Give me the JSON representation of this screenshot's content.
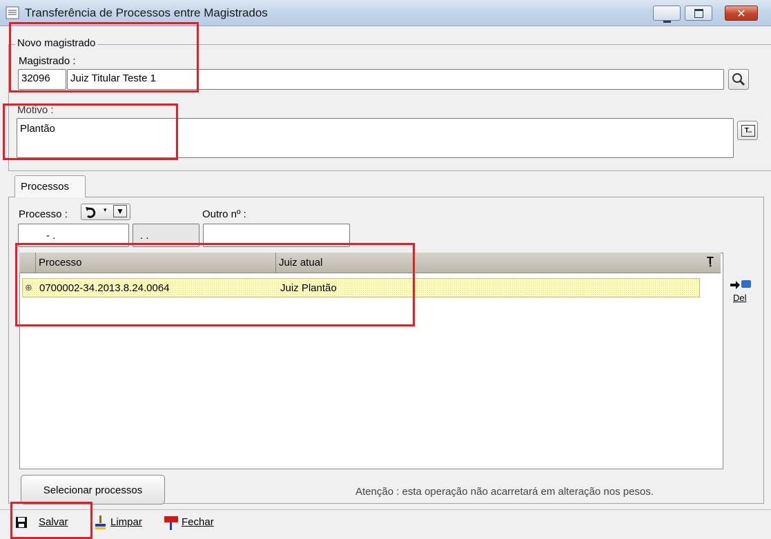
{
  "window": {
    "title": "Transferência de Processos entre Magistrados"
  },
  "novo_magistrado": {
    "legend": "Novo magistrado",
    "magistrado_label": "Magistrado :",
    "code": "32096",
    "name": "Juiz Titular Teste 1"
  },
  "motivo": {
    "label": "Motivo :",
    "value": "Plantão"
  },
  "tabs": [
    {
      "label": "Processos",
      "active": true
    }
  ],
  "processos_panel": {
    "processo_label": "Processo :",
    "processo_field1": " - .",
    "processo_field2": ". .",
    "outro_label": "Outro nº :",
    "outro_value": ""
  },
  "grid": {
    "columns": [
      "Processo",
      "Juiz atual"
    ],
    "rows": [
      {
        "processo": "0700002-34.2013.8.24.0064",
        "juiz_atual": "Juiz Plantão"
      }
    ],
    "del_label": "Del"
  },
  "footer": {
    "select_button": "Selecionar processos",
    "notice": "Atenção : esta operação não acarretará em alteração nos pesos."
  },
  "toolbar": {
    "salvar": "Salvar",
    "limpar": "Limpar",
    "fechar": "Fechar"
  },
  "colors": {
    "highlight_box": "#ec1c24",
    "row_highlight": "#ffffc2",
    "header_bg": "#c9c5ba"
  }
}
